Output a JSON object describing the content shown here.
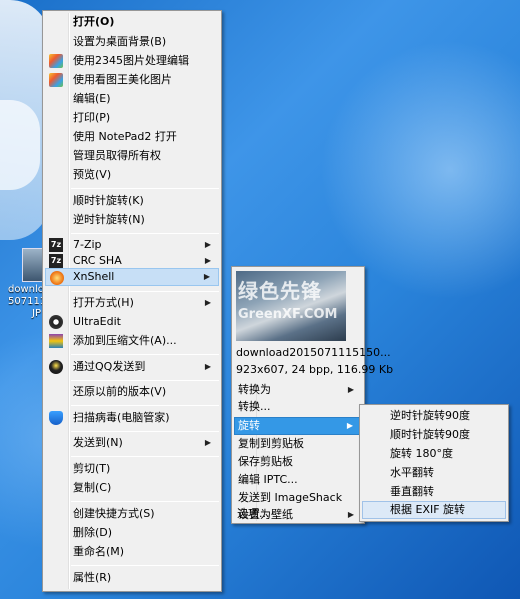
{
  "desktop": {
    "icon_label_line1": "downlo",
    "icon_label_line2": "507111",
    "icon_label_line3": "JP"
  },
  "context_menu": {
    "items": [
      {
        "label": "打开(O)",
        "bold": true
      },
      {
        "label": "设置为桌面背景(B)"
      },
      {
        "label": "使用2345图片处理编辑"
      },
      {
        "label": "使用看图王美化图片"
      },
      {
        "label": "编辑(E)"
      },
      {
        "label": "打印(P)"
      },
      {
        "label": "使用 NotePad2 打开"
      },
      {
        "label": "管理员取得所有权"
      },
      {
        "label": "预览(V)"
      },
      {
        "label": "顺时针旋转(K)"
      },
      {
        "label": "逆时针旋转(N)"
      },
      {
        "label": "7-Zip"
      },
      {
        "label": "CRC SHA"
      },
      {
        "label": "XnShell"
      },
      {
        "label": "打开方式(H)"
      },
      {
        "label": "UltraEdit"
      },
      {
        "label": "添加到压缩文件(A)..."
      },
      {
        "label": "通过QQ发送到"
      },
      {
        "label": "还原以前的版本(V)"
      },
      {
        "label": "扫描病毒(电脑管家)"
      },
      {
        "label": "发送到(N)"
      },
      {
        "label": "剪切(T)"
      },
      {
        "label": "复制(C)"
      },
      {
        "label": "创建快捷方式(S)"
      },
      {
        "label": "删除(D)"
      },
      {
        "label": "重命名(M)"
      },
      {
        "label": "属性(R)"
      }
    ]
  },
  "xnshell_menu": {
    "preview_watermark": "绿色先锋",
    "preview_watermark2": "GreenXF.COM",
    "filename": "download2015071115150...",
    "info": "923x607, 24 bpp, 116.99 Kb",
    "items": [
      {
        "label": "转换为"
      },
      {
        "label": "转换..."
      },
      {
        "label": "旋转"
      },
      {
        "label": "复制到剪贴板"
      },
      {
        "label": "保存剪贴板"
      },
      {
        "label": "编辑 IPTC..."
      },
      {
        "label": "发送到 ImageShack"
      },
      {
        "label": "设置为壁纸"
      },
      {
        "label": "选项..."
      }
    ]
  },
  "rotate_menu": {
    "items": [
      {
        "label": "逆时针旋转90度"
      },
      {
        "label": "顺时针旋转90度"
      },
      {
        "label": "旋转 180°度"
      },
      {
        "label": "水平翻转"
      },
      {
        "label": "垂直翻转"
      },
      {
        "label": "根据 EXIF 旋转"
      }
    ]
  },
  "colors": {
    "highlight_blue": "#3498e6",
    "menu_bg": "#f0f0f0",
    "desktop_blue": "#2a84db"
  }
}
